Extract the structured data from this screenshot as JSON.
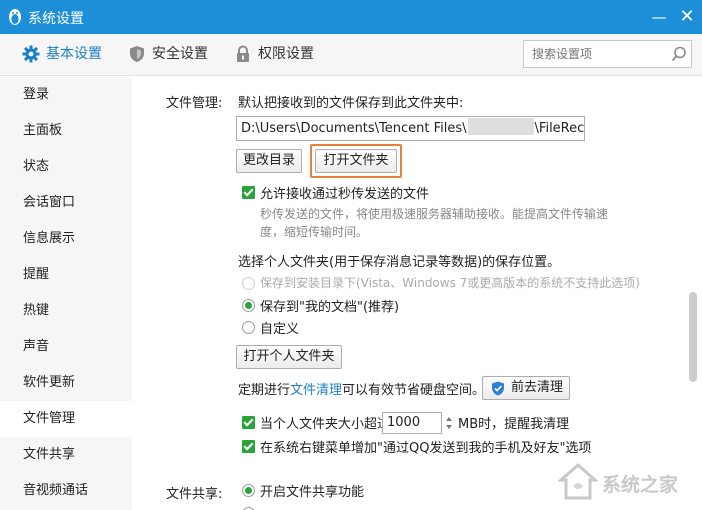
{
  "window": {
    "title": "系统设置",
    "minimize": "—",
    "close": "✕"
  },
  "topnav": {
    "tabs": [
      {
        "label": "基本设置",
        "icon": "gear-icon",
        "active": true
      },
      {
        "label": "安全设置",
        "icon": "shield-icon",
        "active": false
      },
      {
        "label": "权限设置",
        "icon": "lock-icon",
        "active": false
      }
    ],
    "search_placeholder": "搜索设置项"
  },
  "sidebar": {
    "items": [
      "登录",
      "主面板",
      "状态",
      "会话窗口",
      "信息展示",
      "提醒",
      "热键",
      "声音",
      "软件更新",
      "文件管理",
      "文件共享",
      "音视频通话"
    ],
    "active_index": 9
  },
  "file_management": {
    "section_label": "文件管理:",
    "default_desc": "默认把接收到的文件保存到此文件夹中:",
    "path_prefix": "D:\\Users\\Documents\\Tencent Files\\",
    "path_suffix": "\\FileRecv\\",
    "change_dir_button": "更改目录",
    "open_folder_button": "打开文件夹",
    "allow_flash_transfer": {
      "label": "允许接收通过秒传发送的文件",
      "checked": true
    },
    "flash_desc_line1": "秒传发送的文件，将使用极速服务器辅助接收。能提高文件传输速",
    "flash_desc_line2": "度，缩短传输时间。",
    "personal_folder_desc": "选择个人文件夹(用于保存消息记录等数据)的保存位置。",
    "radio_install_dir": "保存到安装目录下(Vista、Windows 7或更高版本的系统不支持此选项)",
    "radio_my_docs": "保存到\"我的文档\"(推荐)",
    "radio_custom": "自定义",
    "open_personal_folder_button": "打开个人文件夹",
    "cleanup_prefix": "定期进行",
    "cleanup_link": "文件清理",
    "cleanup_suffix": "可以有效节省硬盘空间。",
    "cleanup_button": "前去清理",
    "size_limit_before": "当个人文件夹大小超过",
    "size_limit_value": "1000",
    "size_limit_after": "MB时，提醒我清理",
    "context_menu_option": "在系统右键菜单增加\"通过QQ发送到我的手机及好友\"选项"
  },
  "file_sharing": {
    "section_label": "文件共享:",
    "enable_label": "开启文件共享功能"
  },
  "watermark": {
    "text": "系统之家"
  },
  "colors": {
    "titlebar": "#1d8fd9",
    "accent": "#1d7fc4",
    "highlight": "#e5803d",
    "check": "#2aa33a"
  }
}
